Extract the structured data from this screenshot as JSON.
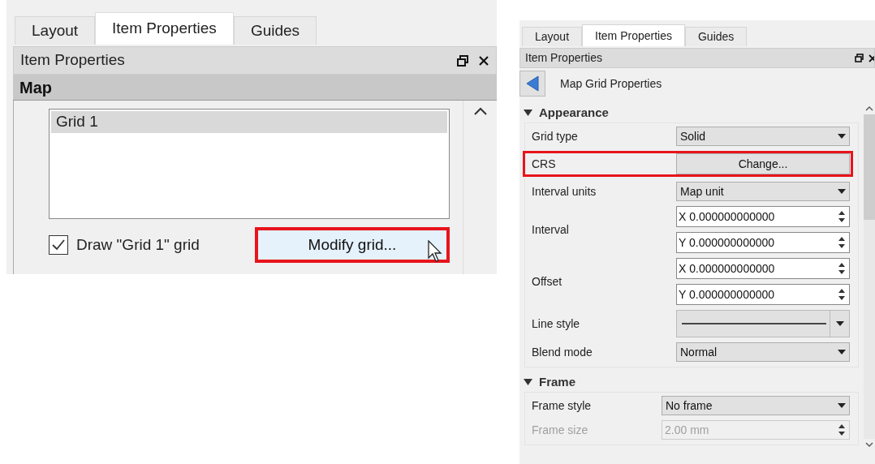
{
  "left_panel": {
    "tabs": [
      {
        "label": "Layout",
        "selected": false
      },
      {
        "label": "Item Properties",
        "selected": true
      },
      {
        "label": "Guides",
        "selected": false
      }
    ],
    "dock_title": "Item Properties",
    "section_title": "Map",
    "grid_list": [
      {
        "label": "Grid 1",
        "selected": true
      }
    ],
    "draw_grid_checkbox": {
      "label": "Draw \"Grid 1\" grid",
      "checked": true
    },
    "modify_button": {
      "label": "Modify grid...",
      "highlighted": true
    }
  },
  "right_panel": {
    "tabs": [
      {
        "label": "Layout",
        "selected": false
      },
      {
        "label": "Item Properties",
        "selected": true
      },
      {
        "label": "Guides",
        "selected": false
      }
    ],
    "dock_title": "Item Properties",
    "page_title": "Map Grid Properties",
    "sections": [
      {
        "title": "Appearance",
        "expanded": true,
        "rows": [
          {
            "kind": "combo",
            "label": "Grid type",
            "value": "Solid",
            "highlighted": false,
            "disabled": false
          },
          {
            "kind": "button",
            "label": "CRS",
            "value": "Change...",
            "highlighted": true,
            "disabled": false
          },
          {
            "kind": "combo",
            "label": "Interval units",
            "value": "Map unit",
            "highlighted": false,
            "disabled": false
          },
          {
            "kind": "spin_pair",
            "label": "Interval",
            "values": [
              "X 0.000000000000",
              "Y 0.000000000000"
            ],
            "highlighted": false,
            "disabled": false
          },
          {
            "kind": "spin_pair",
            "label": "Offset",
            "values": [
              "X 0.000000000000",
              "Y 0.000000000000"
            ],
            "highlighted": false,
            "disabled": false
          },
          {
            "kind": "line_combo",
            "label": "Line style",
            "highlighted": false,
            "disabled": false
          },
          {
            "kind": "combo",
            "label": "Blend mode",
            "value": "Normal",
            "highlighted": false,
            "disabled": false
          }
        ]
      },
      {
        "title": "Frame",
        "expanded": true,
        "rows": [
          {
            "kind": "combo",
            "label": "Frame style",
            "value": "No frame",
            "highlighted": false,
            "disabled": false
          },
          {
            "kind": "spin",
            "label": "Frame size",
            "value": "2.00 mm",
            "highlighted": false,
            "disabled": true
          }
        ]
      }
    ]
  }
}
